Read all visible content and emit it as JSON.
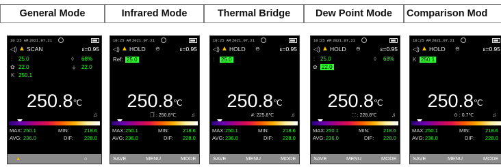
{
  "headers": [
    "General Mode",
    "Infrared Mode",
    "Thermal Bridge",
    "Dew Point Mode",
    "Comparison Mod"
  ],
  "status": {
    "time": "10:25 AM",
    "date": "2021.07.21"
  },
  "emissivity": "ε=0.95",
  "main_temp": "250.8",
  "unit": "℃",
  "stats": {
    "max_label": "MAX:",
    "max": "250.1",
    "min_label": "MIN:",
    "min": "218.6",
    "avg_label": "AVG:",
    "avg": "236.0",
    "dif_label": "DIF:",
    "dif": "228.0"
  },
  "general": {
    "mode": "SCAN",
    "probe": "25.0",
    "humidity": "68%",
    "dew": "22.0",
    "dew2": "22.0",
    "k": "250.1"
  },
  "infrared": {
    "mode": "HOLD",
    "ref_label": "Ref:",
    "ref": "25.0",
    "sub": "🗍 : 250.8℃"
  },
  "thermal": {
    "mode": "HOLD",
    "probe": "25.0",
    "sub": "#: 225.8℃"
  },
  "dewpoint": {
    "mode": "HOLD",
    "probe": "25.0",
    "humidity": "68%",
    "dew": "22.0",
    "sub": "⸬ : 228.8℃"
  },
  "comparison": {
    "mode": "HOLD",
    "k": "250.1",
    "sub": "⊙ : 0.7℃"
  },
  "softkeys": {
    "save": "SAVE",
    "menu": "MENU",
    "mode": "MODE"
  }
}
